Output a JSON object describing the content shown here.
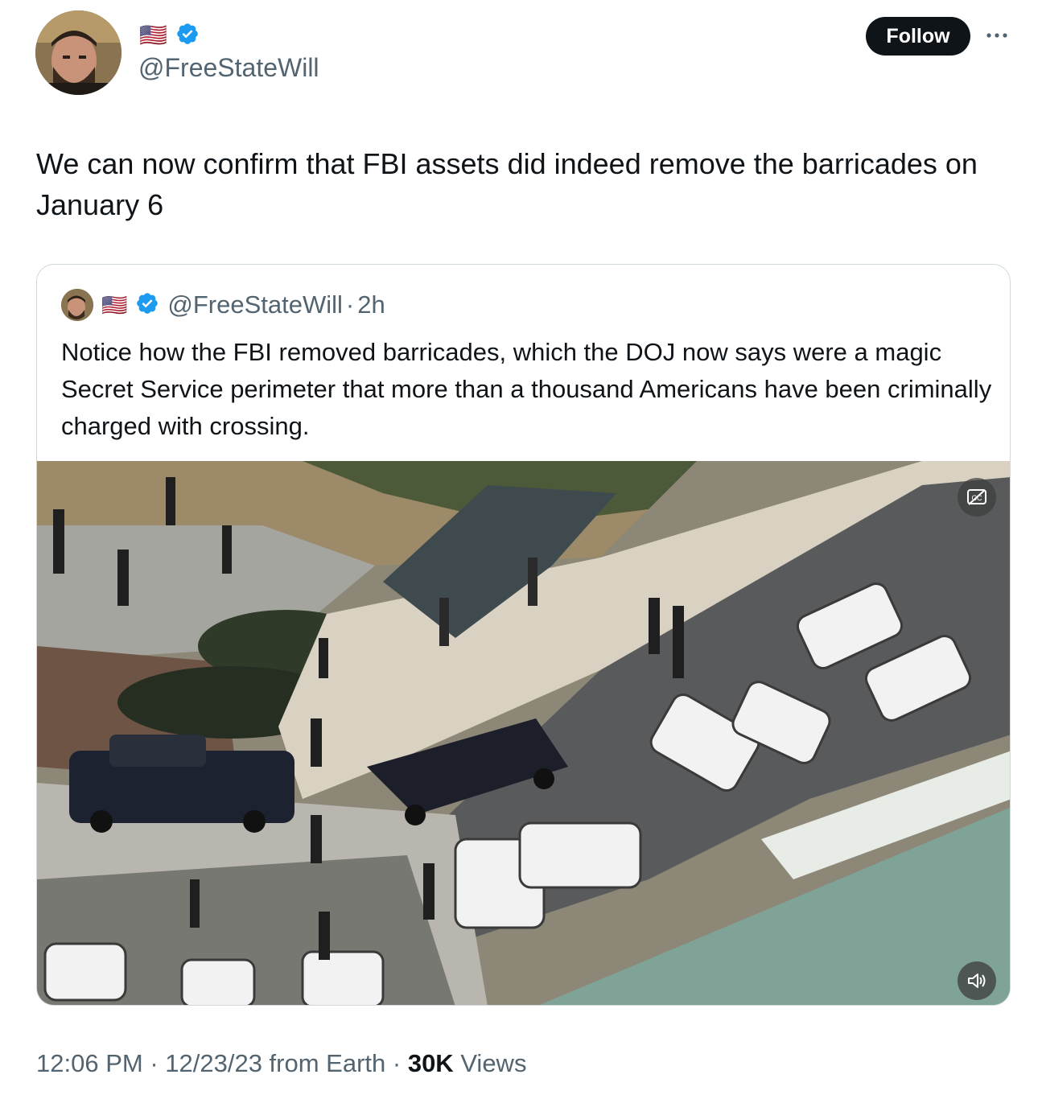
{
  "author": {
    "handle": "@FreeStateWill",
    "flag": "🇺🇸",
    "verified": true
  },
  "follow_label": "Follow",
  "tweet_text": "We can now confirm that FBI assets did indeed remove the barricades on January 6",
  "quote": {
    "handle": "@FreeStateWill",
    "separator": "·",
    "age": "2h",
    "text": "Notice how the FBI removed barricades, which the DOJ now says were a magic Secret Service perimeter that more than a thousand Americans have been criminally charged with crossing.",
    "media": {
      "controls": [
        "captions-icon",
        "mute-icon"
      ]
    }
  },
  "meta": {
    "time": "12:06 PM",
    "sep1": " · ",
    "date": "12/23/23",
    "source": " from Earth",
    "sep2": " · ",
    "views_count": "30K",
    "views_label": " Views"
  },
  "colors": {
    "text": "#0f1419",
    "secondary": "#536471",
    "verified": "#1d9bf0",
    "border": "#cfd9de"
  }
}
